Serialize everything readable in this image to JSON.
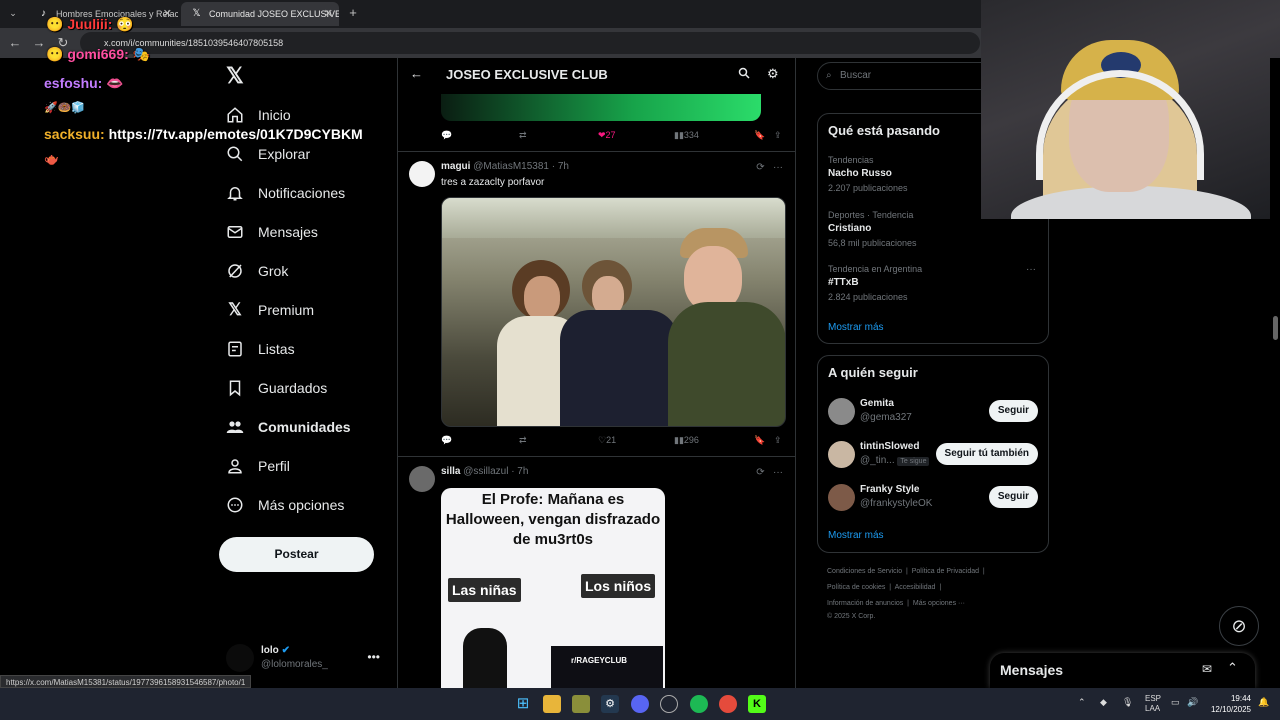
{
  "browser": {
    "tabs": [
      {
        "title": "Hombres Emocionales y Relacio",
        "active": false
      },
      {
        "title": "Comunidad JOSEO EXCLUSIVE",
        "active": true
      }
    ],
    "new_tab": "+",
    "url": "x.com/i/communities/1851039546407805158",
    "status_url": "https://x.com/MatiasM15381/status/1977396158931546587/photo/1"
  },
  "chat": [
    {
      "user": "Juuliii:",
      "color": "#ff3b3b",
      "msg": ""
    },
    {
      "user": "gomi669:",
      "color": "#ff4fa0",
      "msg": ""
    },
    {
      "user": "esfoshu:",
      "color": "#c27cff",
      "msg": ""
    },
    {
      "user": "sacksuu:",
      "color": "#f2b12a",
      "msg": "https://7tv.app/emotes/01K7D9CYBKM"
    }
  ],
  "nav": {
    "items": [
      {
        "label": "Inicio",
        "icon": "home-icon"
      },
      {
        "label": "Explorar",
        "icon": "search-icon"
      },
      {
        "label": "Notificaciones",
        "icon": "bell-icon"
      },
      {
        "label": "Mensajes",
        "icon": "mail-icon"
      },
      {
        "label": "Grok",
        "icon": "grok-icon"
      },
      {
        "label": "Premium",
        "icon": "x-icon"
      },
      {
        "label": "Listas",
        "icon": "list-icon"
      },
      {
        "label": "Guardados",
        "icon": "bookmark-icon"
      },
      {
        "label": "Comunidades",
        "icon": "communities-icon"
      },
      {
        "label": "Perfil",
        "icon": "profile-icon"
      },
      {
        "label": "Más opciones",
        "icon": "more-icon"
      }
    ],
    "post_button": "Postear",
    "account": {
      "name": "lolo",
      "handle": "@lolomorales_"
    }
  },
  "main": {
    "title": "JOSEO EXCLUSIVE CLUB",
    "prev_actions": {
      "likes": "27",
      "views": "334"
    },
    "tweets": [
      {
        "name": "magui",
        "handle": "@MatiasM15381",
        "time": "· 7h",
        "text": "tres a zazaclty porfavor",
        "replies": "",
        "retweets": "",
        "likes": "21",
        "views": "296"
      },
      {
        "name": "silla",
        "handle": "@ssillazul",
        "time": "· 7h",
        "text": ""
      }
    ],
    "meme": {
      "top": "El Profe: Mañana es Halloween, vengan disfrazado de mu3rt0s",
      "left_label": "Las niñas",
      "right_label": "Los niños",
      "badge": "r/RAGEYCLUB"
    }
  },
  "right": {
    "search_placeholder": "Buscar",
    "trends_title": "Qué está pasando",
    "trends": [
      {
        "category": "Tendencias",
        "name": "Nacho Russo",
        "count": "2.207 publicaciones"
      },
      {
        "category": "Deportes · Tendencia",
        "name": "Cristiano",
        "count": "56,8 mil publicaciones"
      },
      {
        "category": "Tendencia en Argentina",
        "name": "#TTxB",
        "count": "2.824 publicaciones"
      }
    ],
    "show_more": "Mostrar más",
    "wtf_title": "A quién seguir",
    "wtf": [
      {
        "name": "Gemita",
        "handle": "@gema327",
        "button": "Seguir",
        "badge": ""
      },
      {
        "name": "tintinSlowed",
        "handle": "@_tin...",
        "button": "Seguir tú también",
        "badge": "Te sigue"
      },
      {
        "name": "Franky Style",
        "handle": "@frankystyleOK",
        "button": "Seguir",
        "badge": ""
      }
    ],
    "footer": [
      "Condiciones de Servicio",
      "Política de Privacidad",
      "Política de cookies",
      "Accesibilidad",
      "Información de anuncios",
      "Más opciones ···",
      "© 2025 X Corp."
    ]
  },
  "messages_dock": {
    "title": "Mensajes"
  },
  "taskbar": {
    "lang1": "ESP",
    "lang2": "LAA",
    "time": "19:44",
    "date": "12/10/2025"
  },
  "colors": {
    "accent": "#1d9bf0",
    "like": "#f91880",
    "bg": "#000000"
  }
}
